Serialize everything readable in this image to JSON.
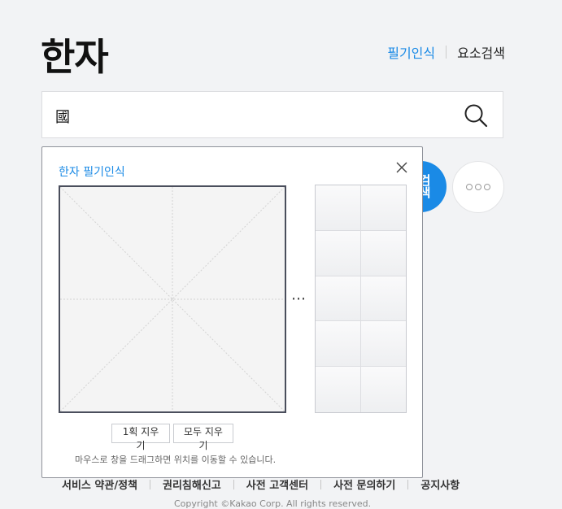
{
  "header": {
    "logo": "한자",
    "links": {
      "handwriting": "필기인식",
      "element_search": "요소검색"
    }
  },
  "search": {
    "value": "國"
  },
  "popup": {
    "title": "한자 필기인식",
    "more_indicator": "⋯",
    "buttons": {
      "undo_stroke": "1획 지우기",
      "clear_all": "모두 지우기"
    },
    "help_text": "마우스로 창을 드래그하면 위치를 이동할 수 있습니다."
  },
  "behind_button": {
    "label": "검색"
  },
  "footer": {
    "links": [
      "서비스 약관/정책",
      "권리침해신고",
      "사전 고객센터",
      "사전 문의하기",
      "공지사항"
    ],
    "copyright": "Copyright ©Kakao Corp. All rights reserved."
  },
  "colors": {
    "accent": "#1a8ae6",
    "background": "#f2f3f5"
  }
}
